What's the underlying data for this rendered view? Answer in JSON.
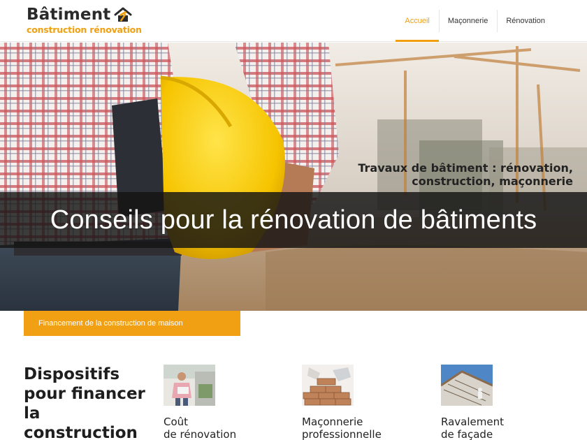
{
  "header": {
    "logo": {
      "title": "Bâtiment",
      "subtitle": "construction rénovation"
    },
    "nav": [
      {
        "label": "Accueil",
        "active": true
      },
      {
        "label": "Maçonnerie",
        "active": false
      },
      {
        "label": "Rénovation",
        "active": false
      }
    ]
  },
  "hero": {
    "caption_line1": "Travaux de bâtiment : rénovation,",
    "caption_line2": "construction, maçonnerie",
    "headline": "Conseils pour la rénovation de bâtiments"
  },
  "tag": {
    "label": "Financement de la construction de maison"
  },
  "section": {
    "heading_lines": [
      "Dispositifs",
      "pour financer",
      "la",
      "construction"
    ],
    "cards": [
      {
        "line1": "Coût",
        "line2": "de rénovation"
      },
      {
        "line1": "Maçonnerie",
        "line2": "professionnelle"
      },
      {
        "line1": "Ravalement",
        "line2": "de façade"
      }
    ]
  },
  "colors": {
    "accent": "#f0a012",
    "text": "#222222",
    "band": "#141414"
  },
  "icons": {
    "logo": "hammer-house-icon"
  }
}
